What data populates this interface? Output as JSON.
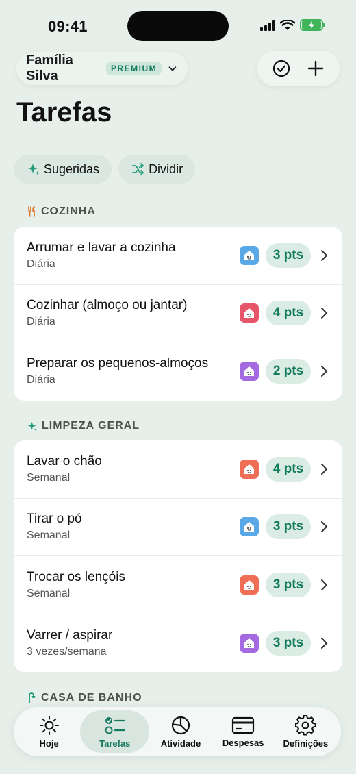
{
  "status_bar": {
    "time": "09:41"
  },
  "header": {
    "family_name": "Família Silva",
    "premium_label": "PREMIUM",
    "title": "Tarefas"
  },
  "filters": [
    {
      "label": "Sugeridas",
      "icon": "sparkle-icon"
    },
    {
      "label": "Dividir",
      "icon": "shuffle-icon"
    }
  ],
  "sections": [
    {
      "title": "COZINHA",
      "icon": "utensils-icon",
      "icon_color": "#e07a2e",
      "tasks": [
        {
          "title": "Arrumar e lavar a cozinha",
          "frequency": "Diária",
          "points": "3 pts",
          "avatar_color": "#5aa9e6",
          "avatar_icon": "house-icon"
        },
        {
          "title": "Cozinhar (almoço ou jantar)",
          "frequency": "Diária",
          "points": "4 pts",
          "avatar_color": "#e5566a",
          "avatar_icon": "house-icon"
        },
        {
          "title": "Preparar os pequenos-almoços",
          "frequency": "Diária",
          "points": "2 pts",
          "avatar_color": "#a46be0",
          "avatar_icon": "house-icon"
        }
      ]
    },
    {
      "title": "LIMPEZA GERAL",
      "icon": "sparkle-icon",
      "icon_color": "#1e9a7a",
      "tasks": [
        {
          "title": "Lavar o chão",
          "frequency": "Semanal",
          "points": "4 pts",
          "avatar_color": "#ee6f55",
          "avatar_icon": "house-icon"
        },
        {
          "title": "Tirar o pó",
          "frequency": "Semanal",
          "points": "3 pts",
          "avatar_color": "#5aa9e6",
          "avatar_icon": "house-icon"
        },
        {
          "title": "Trocar os lençóis",
          "frequency": "Semanal",
          "points": "3 pts",
          "avatar_color": "#ee6f55",
          "avatar_icon": "house-icon"
        },
        {
          "title": "Varrer / aspirar",
          "frequency": "3 vezes/semana",
          "points": "3 pts",
          "avatar_color": "#a46be0",
          "avatar_icon": "house-icon"
        }
      ]
    },
    {
      "title": "CASA DE BANHO",
      "icon": "shower-icon",
      "icon_color": "#1e9a7a",
      "tasks": []
    }
  ],
  "tabs": [
    {
      "label": "Hoje",
      "icon": "sun-icon",
      "active": false
    },
    {
      "label": "Tarefas",
      "icon": "checklist-icon",
      "active": true
    },
    {
      "label": "Atividade",
      "icon": "pie-chart-icon",
      "active": false
    },
    {
      "label": "Despesas",
      "icon": "card-icon",
      "active": false
    },
    {
      "label": "Definições",
      "icon": "gear-icon",
      "active": false
    }
  ],
  "colors": {
    "accent": "#137a5f",
    "background": "#e6efea"
  }
}
